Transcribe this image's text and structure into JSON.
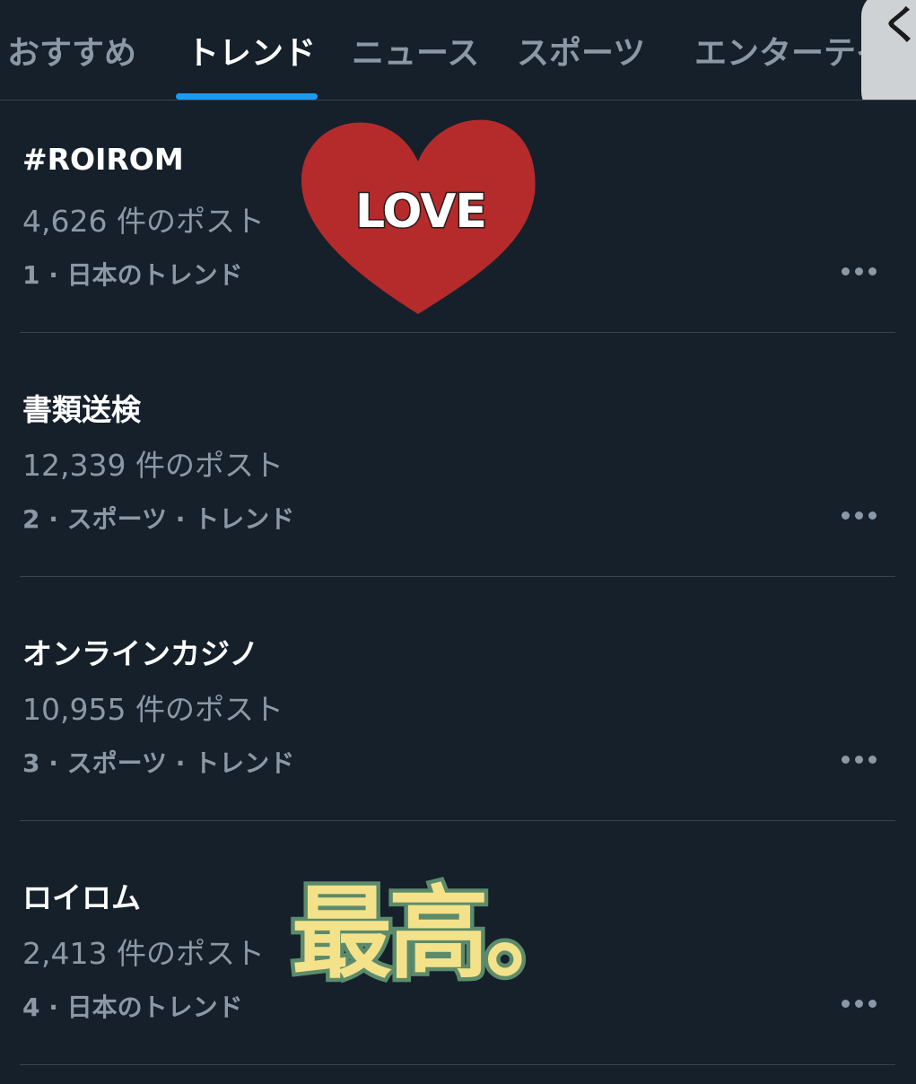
{
  "tabs": [
    {
      "label": "おすすめ",
      "active": false
    },
    {
      "label": "トレンド",
      "active": true
    },
    {
      "label": "ニュース",
      "active": false
    },
    {
      "label": "スポーツ",
      "active": false
    },
    {
      "label": "エンターテイ",
      "active": false
    }
  ],
  "back_button": {
    "glyph": "く"
  },
  "trends": [
    {
      "name": "#ROIROM",
      "count": "4,626 件のポスト",
      "meta": "1 · 日本のトレンド"
    },
    {
      "name": "書類送検",
      "count": "12,339 件のポスト",
      "meta": "2 · スポーツ · トレンド"
    },
    {
      "name": "オンラインカジノ",
      "count": "10,955 件のポスト",
      "meta": "3 · スポーツ · トレンド"
    },
    {
      "name": "ロイロム",
      "count": "2,413 件のポスト",
      "meta": "4 · 日本のトレンド"
    }
  ],
  "stickers": {
    "heart_text": "LOVE",
    "heart_color": "#b52b2b",
    "saiko_text": "最高。",
    "saiko_color": "#f3e28a"
  },
  "colors": {
    "background": "#15202b",
    "accent": "#1d9bf0",
    "text_primary": "#ffffff",
    "text_secondary": "#8b98a5",
    "divider": "#38444d"
  }
}
